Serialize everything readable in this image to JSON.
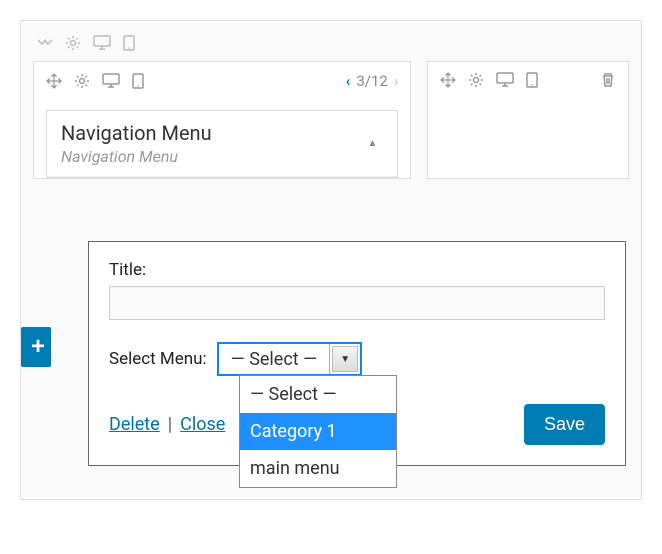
{
  "parent_toolbar": {
    "icons": [
      "chevron-down-icon",
      "gear-icon",
      "desktop-icon",
      "tablet-icon"
    ]
  },
  "left_panel": {
    "toolbar_icons": [
      "move-icon",
      "gear-icon",
      "desktop-icon",
      "tablet-icon"
    ],
    "pager": {
      "current": "3/12"
    }
  },
  "right_panel": {
    "toolbar_icons": [
      "move-icon",
      "gear-icon",
      "desktop-icon",
      "tablet-icon",
      "trash-icon"
    ]
  },
  "widget": {
    "title": "Navigation Menu",
    "subtitle": "Navigation Menu"
  },
  "form": {
    "title_label": "Title:",
    "title_value": "",
    "select_menu_label": "Select Menu:",
    "select_value": "— Select —",
    "options": [
      "— Select —",
      "Category 1",
      "main menu"
    ],
    "selected_index": 1,
    "delete_label": "Delete",
    "close_label": "Close",
    "save_label": "Save"
  },
  "add_button": "+"
}
